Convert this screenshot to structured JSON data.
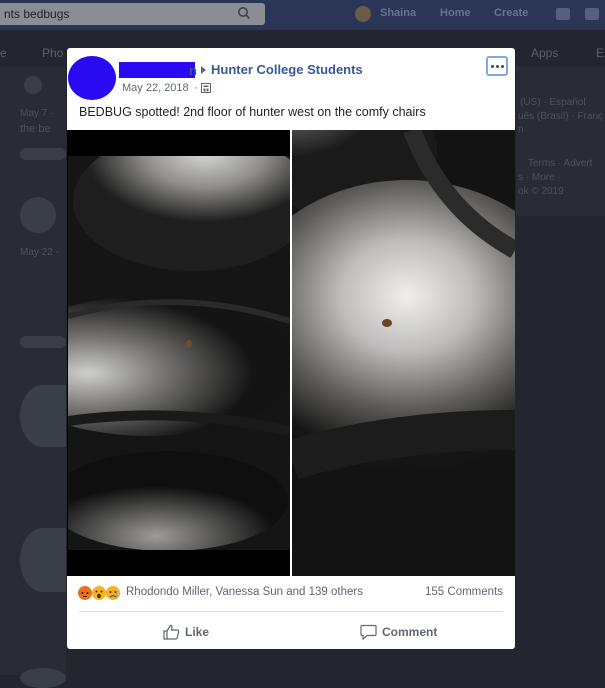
{
  "topbar": {
    "search_value": "nts bedbugs",
    "user_name": "Shaina",
    "nav": [
      "Home",
      "Create"
    ]
  },
  "subnav": {
    "left": [
      "e",
      "Pho"
    ],
    "right": [
      "Apps",
      "E"
    ]
  },
  "background": {
    "sidebar_lines": [
      "(US) · Español",
      "uês (Brasil) · Franç",
      "n",
      "Terms · Advert",
      "s · More ·",
      "ok © 2019"
    ],
    "feed_dates": [
      "May 7 ·",
      "the be",
      "May 22 ·"
    ]
  },
  "post": {
    "author_visible_suffix": "n",
    "group": "Hunter College Students",
    "date": "May 22, 2018",
    "dot": "·",
    "text": "BEDBUG spotted! 2nd floor of hunter west on the comfy chairs",
    "reaction_names": "Rhodondo Miller, Vanessa Sun and 139 others",
    "comments": "155 Comments",
    "like_label": "Like",
    "comment_label": "Comment"
  },
  "colors": {
    "link": "#385898",
    "redaction": "#2a0af2",
    "backdrop": "#23262e"
  },
  "icons": [
    "search-icon",
    "globe-icon",
    "more-icon",
    "like-icon",
    "comment-icon",
    "angry-reaction-icon",
    "wow-reaction-icon",
    "sad-reaction-icon"
  ]
}
